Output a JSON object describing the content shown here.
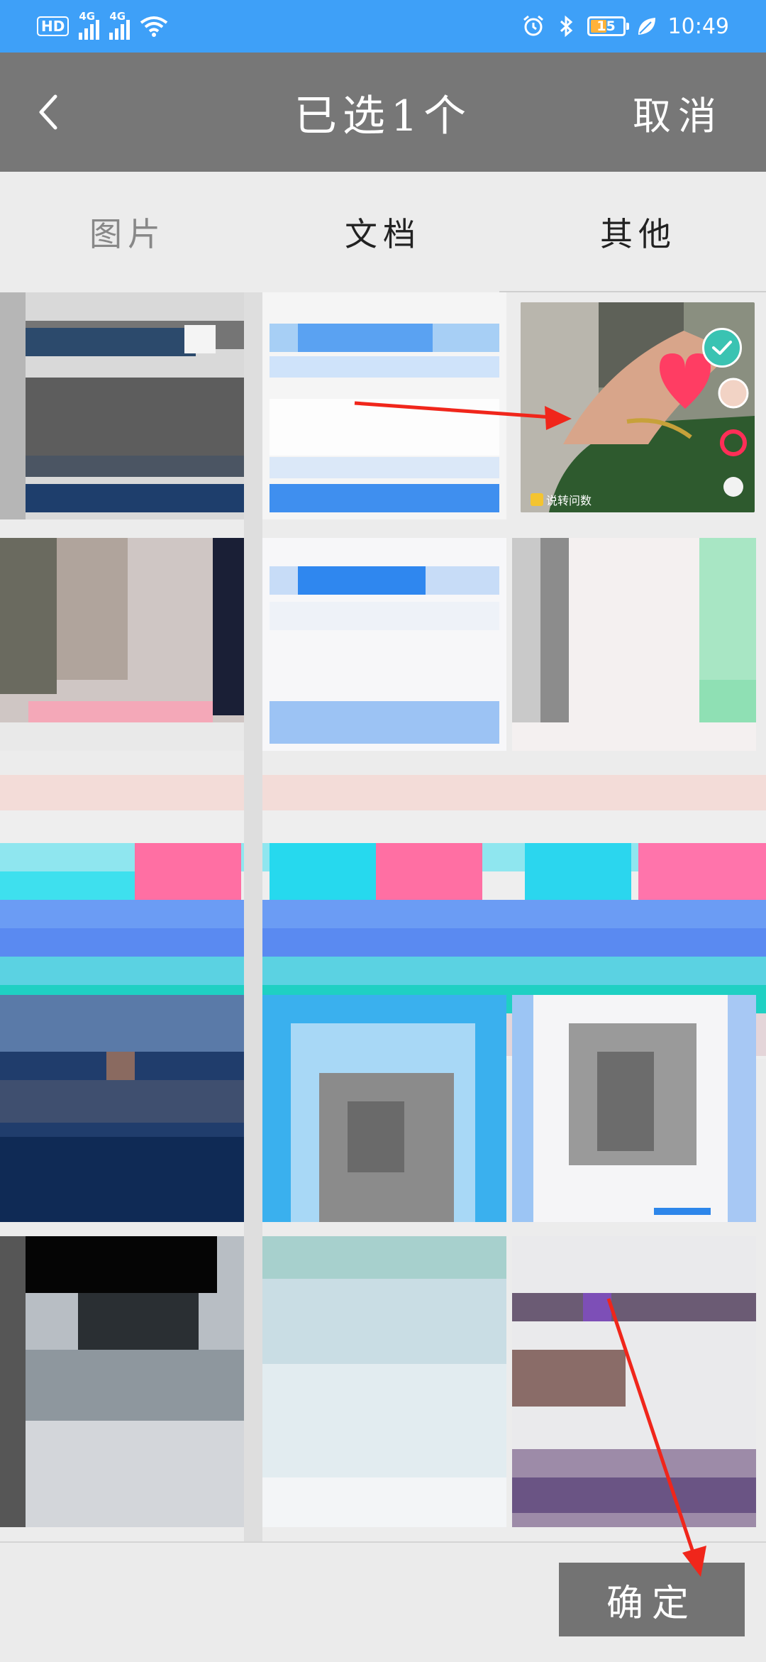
{
  "status_bar": {
    "hd_label": "HD",
    "network_1": "4G",
    "network_2": "4G",
    "battery_level": "15",
    "time": "10:49",
    "icons": [
      "hd-voice-icon",
      "signal-icon",
      "signal-icon",
      "wifi-icon",
      "alarm-icon",
      "bluetooth-icon",
      "battery-icon",
      "leaf-icon"
    ]
  },
  "header": {
    "back_icon": "chevron-left-icon",
    "title": "已选1个",
    "cancel_label": "取消"
  },
  "tabs": [
    {
      "label": "图片",
      "active": true
    },
    {
      "label": "文档",
      "active": false
    },
    {
      "label": "其他",
      "active": false
    }
  ],
  "selected_item": {
    "caption": "说转问数",
    "icon": "check-icon"
  },
  "footer": {
    "confirm_label": "确定"
  },
  "colors": {
    "status_bar": "#3ea0f8",
    "title_bar": "#777777",
    "confirm_button": "#737373",
    "check_badge": "#3ac3b2",
    "annotation_arrow": "#f0261b"
  }
}
